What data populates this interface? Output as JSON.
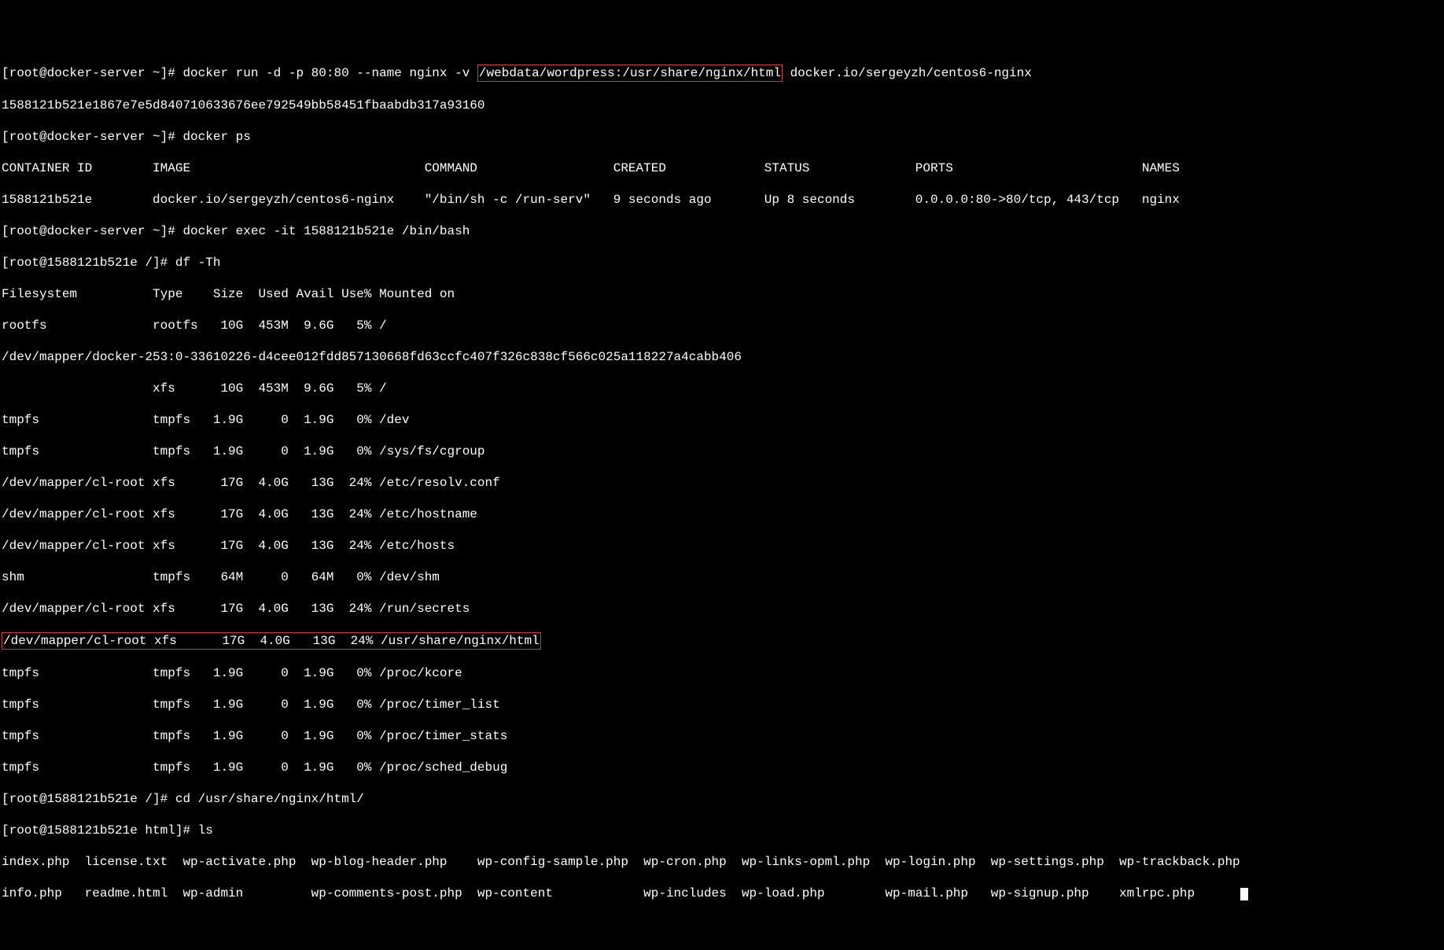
{
  "lines": {
    "l1_prompt": "[root@docker-server ~]# ",
    "l1_cmd_before": "docker run -d -p 80:80 --name nginx -v ",
    "l1_highlighted": "/webdata/wordpress:/usr/share/nginx/html",
    "l1_cmd_after": " docker.io/sergeyzh/centos6-nginx",
    "l2": "1588121b521e1867e7e5d840710633676ee792549bb58451fbaabdb317a93160",
    "l3_prompt": "[root@docker-server ~]# ",
    "l3_cmd": "docker ps",
    "psheader": "CONTAINER ID        IMAGE                               COMMAND                  CREATED             STATUS              PORTS                         NAMES",
    "psrow": "1588121b521e        docker.io/sergeyzh/centos6-nginx    \"/bin/sh -c /run-serv\"   9 seconds ago       Up 8 seconds        0.0.0.0:80->80/tcp, 443/tcp   nginx",
    "l6_prompt": "[root@docker-server ~]# ",
    "l6_cmd": "docker exec -it 1588121b521e /bin/bash",
    "l7_prompt": "[root@1588121b521e /]# ",
    "l7_cmd": "df -Th",
    "dfheader": "Filesystem          Type    Size  Used Avail Use% Mounted on",
    "df1": "rootfs              rootfs   10G  453M  9.6G   5% /",
    "df2": "/dev/mapper/docker-253:0-33610226-d4cee012fdd857130668fd63ccfc407f326c838cf566c025a118227a4cabb406",
    "df3": "                    xfs      10G  453M  9.6G   5% /",
    "df4": "tmpfs               tmpfs   1.9G     0  1.9G   0% /dev",
    "df5": "tmpfs               tmpfs   1.9G     0  1.9G   0% /sys/fs/cgroup",
    "df6": "/dev/mapper/cl-root xfs      17G  4.0G   13G  24% /etc/resolv.conf",
    "df7": "/dev/mapper/cl-root xfs      17G  4.0G   13G  24% /etc/hostname",
    "df8": "/dev/mapper/cl-root xfs      17G  4.0G   13G  24% /etc/hosts",
    "df9": "shm                 tmpfs    64M     0   64M   0% /dev/shm",
    "df10": "/dev/mapper/cl-root xfs      17G  4.0G   13G  24% /run/secrets",
    "df11": "/dev/mapper/cl-root xfs      17G  4.0G   13G  24% /usr/share/nginx/html",
    "df12": "tmpfs               tmpfs   1.9G     0  1.9G   0% /proc/kcore",
    "df13": "tmpfs               tmpfs   1.9G     0  1.9G   0% /proc/timer_list",
    "df14": "tmpfs               tmpfs   1.9G     0  1.9G   0% /proc/timer_stats",
    "df15": "tmpfs               tmpfs   1.9G     0  1.9G   0% /proc/sched_debug",
    "l24_prompt": "[root@1588121b521e /]# ",
    "l24_cmd": "cd /usr/share/nginx/html/",
    "l25_prompt": "[root@1588121b521e html]# ",
    "l25_cmd": "ls",
    "ls1": "index.php  license.txt  wp-activate.php  wp-blog-header.php    wp-config-sample.php  wp-cron.php  wp-links-opml.php  wp-login.php  wp-settings.php  wp-trackback.php",
    "ls2": "info.php   readme.html  wp-admin         wp-comments-post.php  wp-content            wp-includes  wp-load.php        wp-mail.php   wp-signup.php    xmlrpc.php"
  }
}
